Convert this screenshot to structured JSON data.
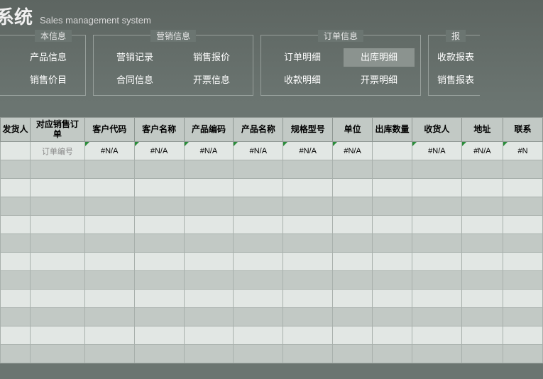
{
  "title": {
    "cn": "系统",
    "en": "Sales management system"
  },
  "nav": {
    "groups": [
      {
        "label": "本信息",
        "partial": "left",
        "rows": [
          [
            "产品信息"
          ],
          [
            "销售价目"
          ]
        ]
      },
      {
        "label": "营销信息",
        "rows": [
          [
            "营销记录",
            "销售报价"
          ],
          [
            "合同信息",
            "开票信息"
          ]
        ]
      },
      {
        "label": "订单信息",
        "rows": [
          [
            "订单明细",
            "出库明细"
          ],
          [
            "收款明细",
            "开票明细"
          ]
        ],
        "active": "出库明细"
      },
      {
        "label": "报",
        "partial": "right",
        "rows": [
          [
            "收款报表"
          ],
          [
            "销售报表"
          ]
        ]
      }
    ]
  },
  "table": {
    "headers": [
      "发货人",
      "对应销售订单",
      "客户代码",
      "客户名称",
      "产品编码",
      "产品名称",
      "规格型号",
      "单位",
      "出库数量",
      "收货人",
      "地址",
      "联系"
    ],
    "rows": [
      {
        "cells": [
          "",
          "订单编号",
          "#N/A",
          "#N/A",
          "#N/A",
          "#N/A",
          "#N/A",
          "#N/A",
          "",
          "#N/A",
          "#N/A",
          "#N"
        ],
        "marks": [
          false,
          false,
          true,
          true,
          true,
          true,
          true,
          true,
          false,
          true,
          true,
          true
        ],
        "placeholder_idx": 1
      }
    ],
    "empty_rows": 11
  }
}
